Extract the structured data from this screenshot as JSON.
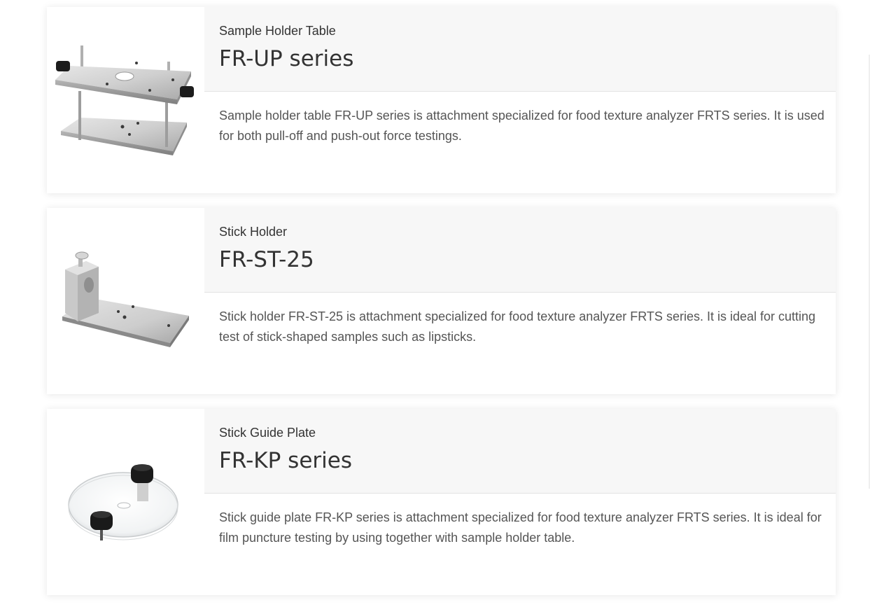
{
  "products": [
    {
      "category": "Sample Holder Table",
      "model": "FR-UP series",
      "description": "Sample holder table FR-UP series is attachment specialized for food texture analyzer FRTS series. It is used for both pull-off and push-out force testings.",
      "image": "sample-holder-table-photo"
    },
    {
      "category": "Stick Holder",
      "model": "FR-ST-25",
      "description": "Stick holder FR-ST-25 is attachment specialized for food texture analyzer FRTS series. It is ideal for cutting test of stick-shaped samples such as lipsticks.",
      "image": "stick-holder-photo"
    },
    {
      "category": "Stick Guide Plate",
      "model": "FR-KP series",
      "description": "Stick guide plate FR-KP series is attachment specialized for food texture analyzer FRTS series. It is ideal for film puncture testing by using together with sample holder table.",
      "image": "stick-guide-plate-photo"
    }
  ]
}
